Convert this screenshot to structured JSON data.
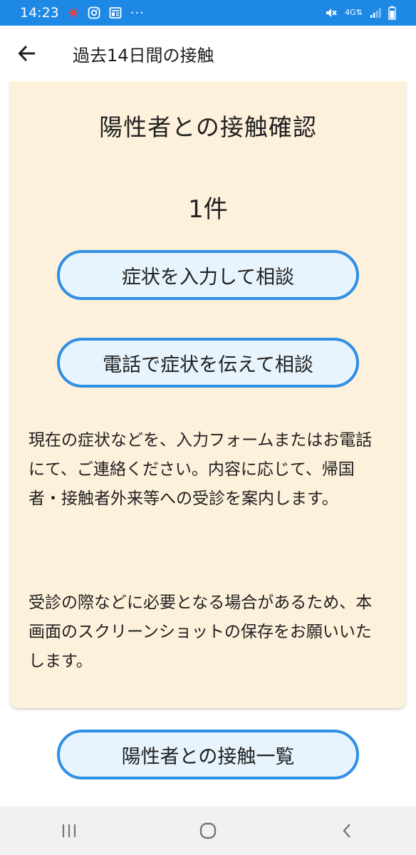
{
  "status_bar": {
    "time": "14:23",
    "more": "···",
    "network": "4G",
    "icons": [
      "notification-dot-icon",
      "instagram-icon",
      "news-icon",
      "mute-icon",
      "signal-icon",
      "battery-icon"
    ]
  },
  "app_bar": {
    "title": "過去14日間の接触",
    "back_icon": "arrow-left-icon"
  },
  "card": {
    "title": "陽性者との接触確認",
    "count": "1件",
    "input_button_label": "症状を入力して相談",
    "phone_button_label": "電話で症状を伝えて相談",
    "paragraph_1": "現在の症状などを、入力フォームまたはお電話にて、ご連絡ください。内容に応じて、帰国者・接触者外来等への受診を案内します。",
    "paragraph_2": "受診の際などに必要となる場合があるため、本画面のスクリーンショットの保存をお願いいたします。"
  },
  "list_button_label": "陽性者との接触一覧",
  "colors": {
    "status_bar": "#1e88e5",
    "card_background": "#fef1dc",
    "button_border": "#2f8fe4",
    "button_fill": "#e7f4fd",
    "nav_bar": "#f1f1f1"
  },
  "nav_bar": {
    "icons": [
      "recent-apps-icon",
      "home-icon",
      "back-icon"
    ]
  }
}
